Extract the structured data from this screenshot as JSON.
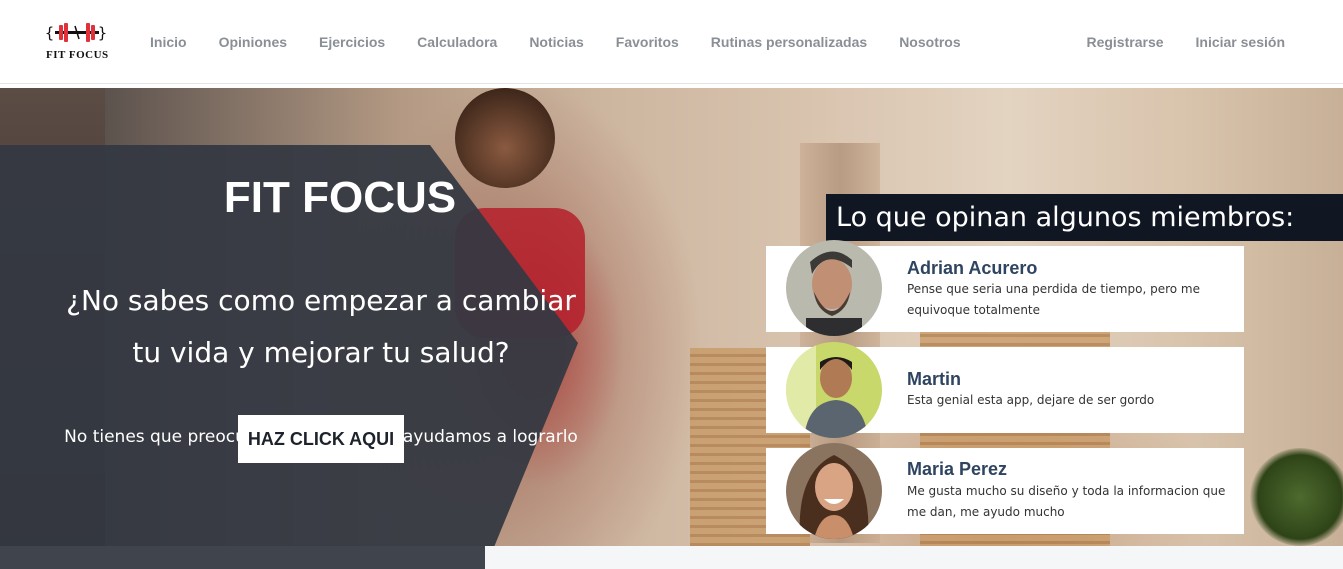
{
  "brand": {
    "name": "FIT FOCUS",
    "logo_icon": "dumbbell-icon",
    "accent": "#e0303a"
  },
  "nav": {
    "links": [
      "Inicio",
      "Opiniones",
      "Ejercicios",
      "Calculadora",
      "Noticias",
      "Favoritos",
      "Rutinas personalizadas",
      "Nosotros"
    ],
    "register": "Registrarse",
    "login": "Iniciar sesión"
  },
  "hero": {
    "title": "FIT FOCUS",
    "question_line1": "¿No sabes como empezar a cambiar",
    "question_line2": "tu vida y mejorar tu salud?",
    "subtitle": "No tienes que preocuparte, nosotros te ayudamos a lograrlo",
    "cta": "HAZ CLICK AQUI"
  },
  "testimonials": {
    "heading": "Lo que opinan algunos miembros:",
    "items": [
      {
        "name": "Adrian Acurero",
        "text": "Pense que seria una perdida de tiempo, pero me equivoque totalmente"
      },
      {
        "name": "Martin",
        "text": "Esta genial esta app, dejare de ser gordo"
      },
      {
        "name": "Maria Perez",
        "text": "Me gusta mucho su diseño y toda la informacion que me dan, me ayudo mucho"
      }
    ]
  },
  "colors": {
    "panel": "#343842",
    "heading_bg": "#101722",
    "name": "#2e4460",
    "nav_text": "#8a8f96"
  }
}
